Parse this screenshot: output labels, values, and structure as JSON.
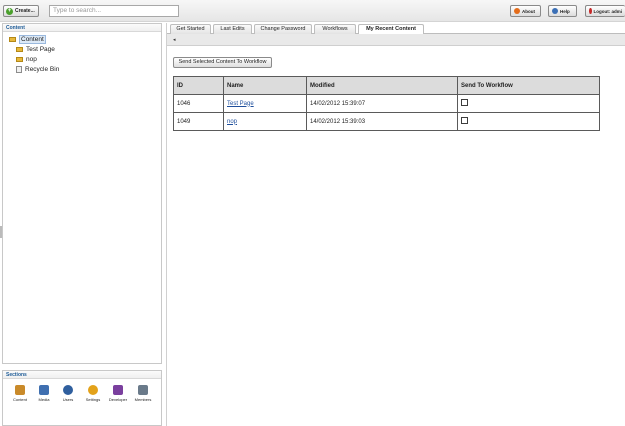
{
  "toolbar": {
    "create_label": "Create...",
    "search_placeholder": "Type to search...",
    "about_label": "About",
    "help_label": "Help",
    "logout_label": "Logout: admi"
  },
  "tree": {
    "header": "Content",
    "items": [
      {
        "label": "Content",
        "icon": "folder-icon"
      },
      {
        "label": "Test Page",
        "icon": "folder-icon"
      },
      {
        "label": "nop",
        "icon": "folder-icon"
      },
      {
        "label": "Recycle Bin",
        "icon": "recycle-bin-icon"
      }
    ]
  },
  "sections": {
    "header": "Sections",
    "items": [
      {
        "label": "Content",
        "icon": "content-icon",
        "color": "#c98a2a"
      },
      {
        "label": "Media",
        "icon": "media-icon",
        "color": "#3f6fb0"
      },
      {
        "label": "Users",
        "icon": "users-icon",
        "color": "#2f5f9e"
      },
      {
        "label": "Settings",
        "icon": "settings-icon",
        "color": "#e3a21a"
      },
      {
        "label": "Developer",
        "icon": "developer-icon",
        "color": "#7a3f9e"
      },
      {
        "label": "Members",
        "icon": "members-icon",
        "color": "#6a7a8a"
      }
    ]
  },
  "tabs": [
    {
      "label": "Get Started"
    },
    {
      "label": "Last Edits"
    },
    {
      "label": "Change Password"
    },
    {
      "label": "Workflows"
    },
    {
      "label": "My Recent Content"
    }
  ],
  "main": {
    "send_button": "Send Selected Content To Workflow",
    "columns": [
      "ID",
      "Name",
      "Modified",
      "Send To Workflow"
    ],
    "rows": [
      {
        "id": "1046",
        "name": "Test Page",
        "modified": "14/02/2012 15:39:07"
      },
      {
        "id": "1049",
        "name": "nop",
        "modified": "14/02/2012 15:39:03"
      }
    ]
  }
}
